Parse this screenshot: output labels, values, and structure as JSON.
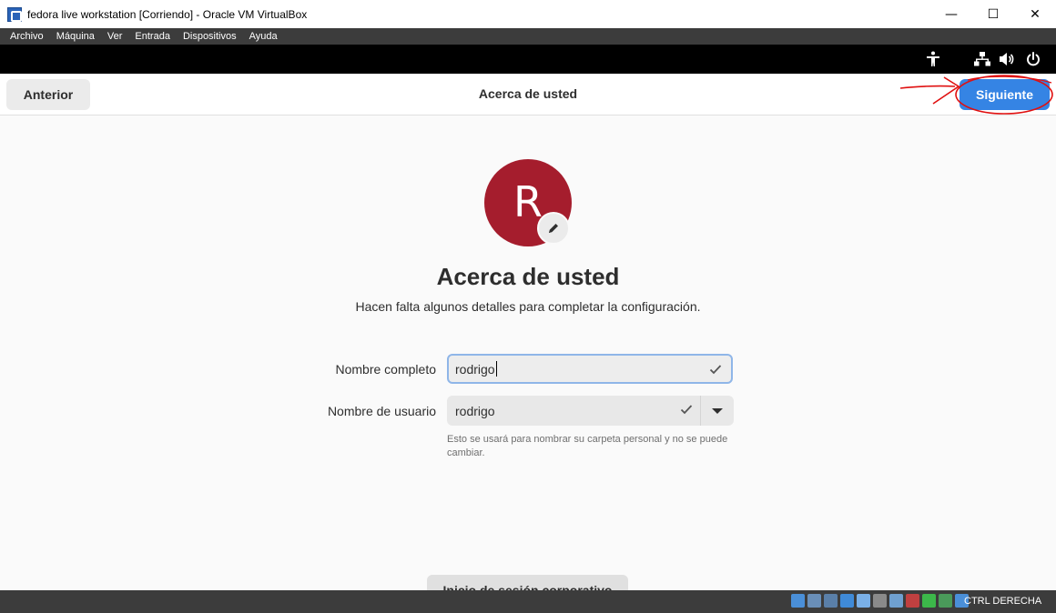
{
  "window": {
    "title": "fedora live workstation [Corriendo] - Oracle VM VirtualBox",
    "minimize": "—",
    "maximize": "☐",
    "close": "✕"
  },
  "menu": [
    "Archivo",
    "Máquina",
    "Ver",
    "Entrada",
    "Dispositivos",
    "Ayuda"
  ],
  "topbar_icons": [
    "accessibility-icon",
    "network-icon",
    "volume-icon",
    "power-icon"
  ],
  "header": {
    "back_label": "Anterior",
    "title": "Acerca de usted",
    "next_label": "Siguiente"
  },
  "avatar": {
    "letter": "R",
    "color": "#a51d2d"
  },
  "page": {
    "title": "Acerca de usted",
    "subtitle": "Hacen falta algunos detalles para completar la configuración."
  },
  "form": {
    "fullname_label": "Nombre completo",
    "fullname_value": "rodrigo",
    "username_label": "Nombre de usuario",
    "username_value": "rodrigo",
    "hint": "Esto se usará para nombrar su carpeta personal y no se puede cambiar."
  },
  "enterprise_button": "Inicio de sesión corporativo",
  "statusbar": {
    "host_key": "CTRL DERECHA",
    "tray_icons": [
      "hdd-icon",
      "optical-icon",
      "audio-icon",
      "network-icon",
      "usb-icon",
      "shared-folder-icon",
      "display-icon",
      "recording-icon",
      "cpu-icon",
      "mouse-icon",
      "keyboard-icon"
    ]
  },
  "colors": {
    "accent": "#3584e4",
    "annotation": "#e01010",
    "avatar": "#a51d2d"
  }
}
